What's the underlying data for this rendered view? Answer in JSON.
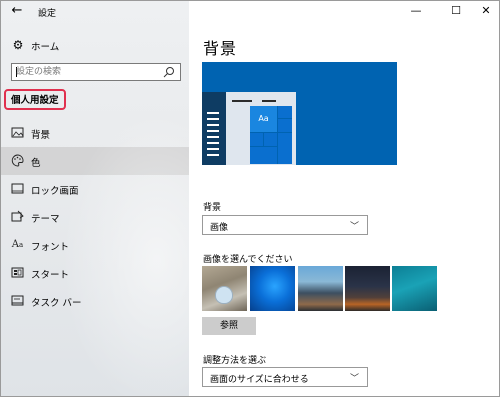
{
  "window": {
    "app_title": "設定",
    "minimize": "—",
    "maximize": "☐",
    "close": "✕"
  },
  "sidebar": {
    "home_label": "ホーム",
    "search_placeholder": "設定の検索",
    "section_title": "個人用設定",
    "items": [
      {
        "label": "背景",
        "icon": "picture-icon"
      },
      {
        "label": "色",
        "icon": "palette-icon"
      },
      {
        "label": "ロック画面",
        "icon": "lock-screen-icon"
      },
      {
        "label": "テーマ",
        "icon": "theme-icon"
      },
      {
        "label": "フォント",
        "icon": "font-icon"
      },
      {
        "label": "スタート",
        "icon": "start-icon"
      },
      {
        "label": "タスク バー",
        "icon": "taskbar-icon"
      }
    ],
    "selected_index": 1
  },
  "main": {
    "page_title": "背景",
    "preview_sample_text": "Aa",
    "background_label": "背景",
    "background_value": "画像",
    "choose_image_label": "画像を選んでください",
    "browse_label": "参照",
    "fit_label": "調整方法を選ぶ",
    "fit_value": "画面のサイズに合わせる"
  },
  "colors": {
    "accent": "#0063b1",
    "highlight_border": "#e0304e"
  }
}
